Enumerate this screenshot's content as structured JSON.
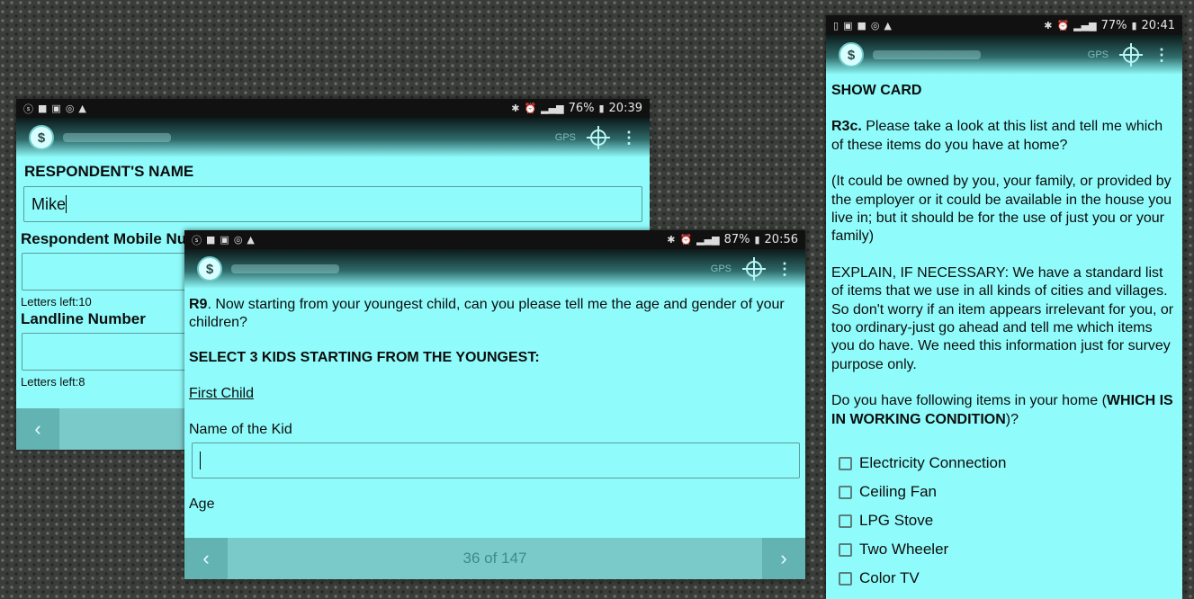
{
  "screen_left": {
    "status": {
      "battery": "76%",
      "time": "20:39"
    },
    "appbar": {
      "gps": "GPS"
    },
    "label_name": "RESPONDENT'S NAME",
    "name_value": "Mike",
    "label_mobile": "Respondent Mobile Num",
    "letters_left_1": "Letters left:10",
    "label_landline": "Landline Number",
    "letters_left_2": "Letters left:8",
    "nav_prev": "‹"
  },
  "screen_center": {
    "status": {
      "battery": "87%",
      "time": "20:56"
    },
    "appbar": {
      "gps": "GPS"
    },
    "question_id": "R9",
    "question_text": ". Now starting from your youngest child, can you please tell me the age and gender of your children?",
    "instruction": "SELECT 3 KIDS STARTING FROM THE YOUNGEST:",
    "section_title": "First Child",
    "label_kid_name": "Name of the Kid",
    "label_age": "Age",
    "progress": "36 of 147",
    "nav_prev": "‹",
    "nav_next": "›"
  },
  "screen_right": {
    "status": {
      "battery": "77%",
      "time": "20:41"
    },
    "appbar": {
      "gps": "GPS"
    },
    "heading": "SHOW CARD",
    "question_id": "R3c.",
    "question_text": " Please take a look at this list and tell me which of these items do you have at home?",
    "note": "(It could be owned by you, your family, or provided by the employer or it could be available in the house you live in; but it should be for the use of just you or your family)",
    "explain": "EXPLAIN, IF NECESSARY: We have a standard list of items that we use in all kinds of cities and villages. So don't worry if an item appears irrelevant for you, or too ordinary-just go ahead and tell me which items you do have. We need this information just for survey purpose only.",
    "prompt_prefix": "Do you have following items in your home (",
    "prompt_bold": "WHICH IS IN WORKING CONDITION",
    "prompt_suffix": ")?",
    "options": [
      "Electricity Connection",
      "Ceiling Fan",
      "LPG Stove",
      "Two Wheeler",
      "Color TV"
    ]
  }
}
